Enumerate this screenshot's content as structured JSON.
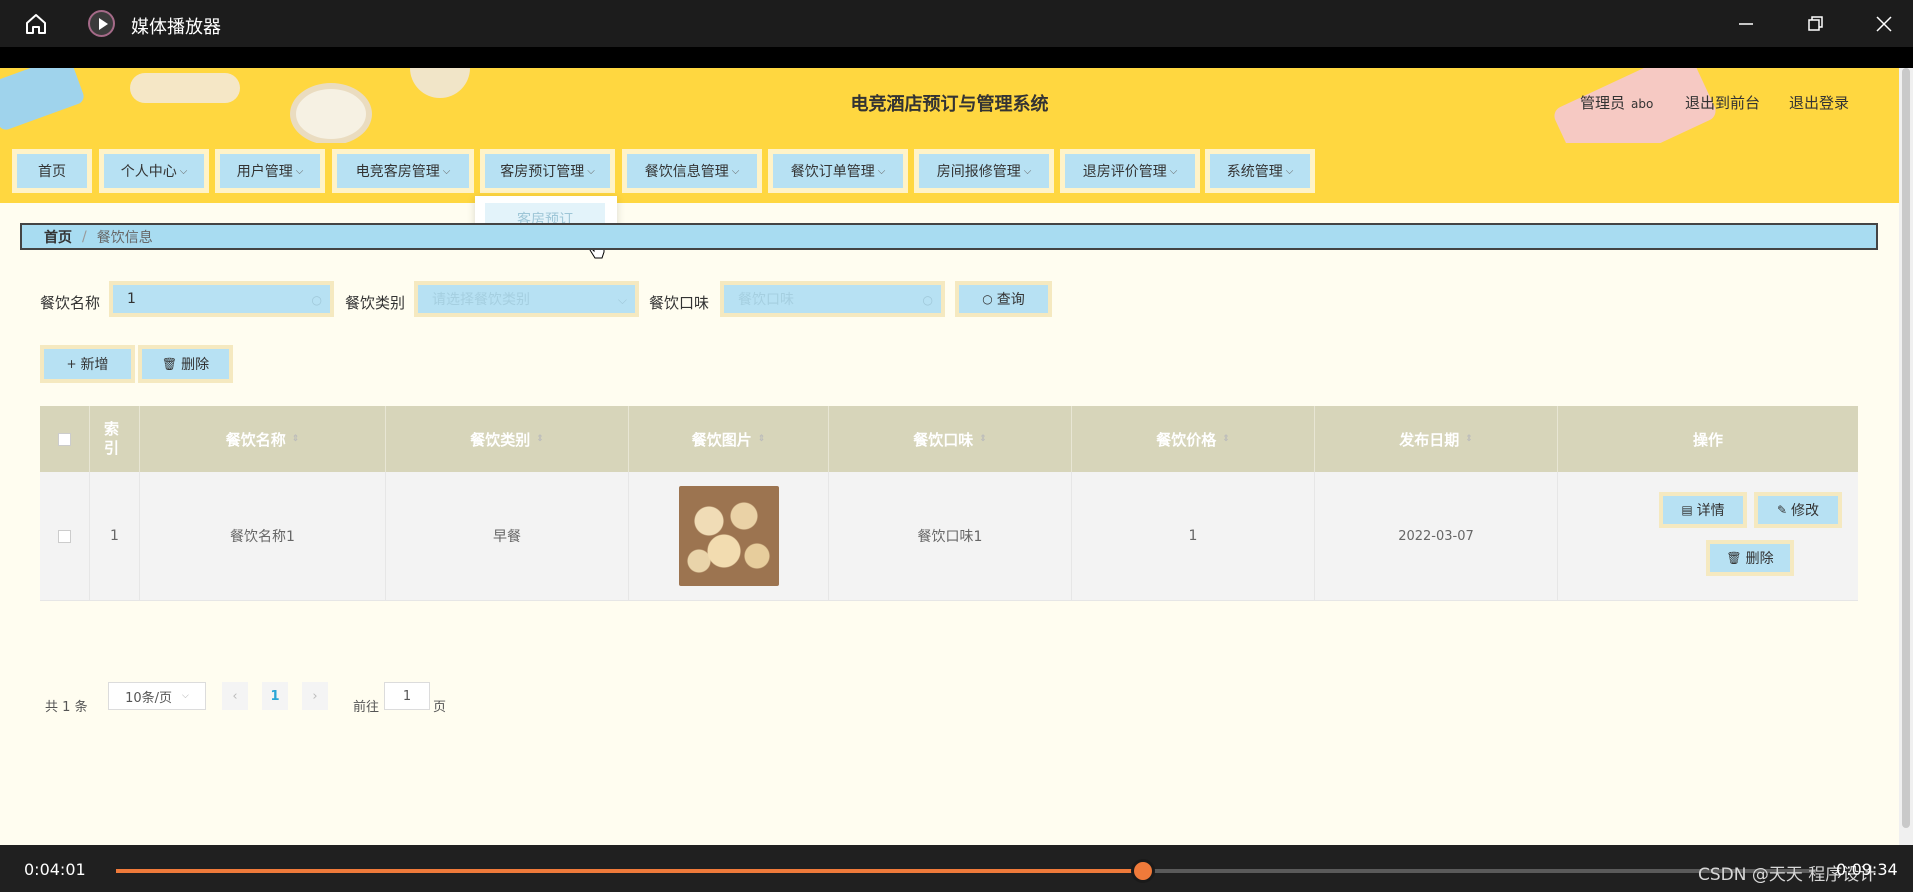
{
  "window": {
    "app_name": "媒体播放器"
  },
  "header": {
    "site_title": "电竞酒店预订与管理系统",
    "user_role": "管理员",
    "user_name": "abo",
    "back_to_front": "退出到前台",
    "logout": "退出登录"
  },
  "nav": {
    "items": [
      "首页",
      "个人中心",
      "用户管理",
      "电竞客房管理",
      "客房预订管理",
      "餐饮信息管理",
      "餐饮订单管理",
      "房间报修管理",
      "退房评价管理",
      "系统管理"
    ],
    "dropdown_item": "客房预订"
  },
  "breadcrumb": {
    "home": "首页",
    "current": "餐饮信息"
  },
  "search": {
    "name_label": "餐饮名称",
    "name_value": "1",
    "category_label": "餐饮类别",
    "category_placeholder": "请选择餐饮类别",
    "taste_label": "餐饮口味",
    "taste_placeholder": "餐饮口味",
    "query_button": "查询"
  },
  "actions": {
    "add": "新增",
    "delete": "删除"
  },
  "table": {
    "headers": {
      "index": "索引",
      "name": "餐饮名称",
      "category": "餐饮类别",
      "image": "餐饮图片",
      "taste": "餐饮口味",
      "price": "餐饮价格",
      "date": "发布日期",
      "ops": "操作"
    },
    "rows": [
      {
        "index": "1",
        "name": "餐饮名称1",
        "category": "早餐",
        "taste": "餐饮口味1",
        "price": "1",
        "date": "2022-03-07",
        "detail": "详情",
        "edit": "修改",
        "delete": "删除"
      }
    ]
  },
  "pagination": {
    "total_prefix": "共",
    "total": "1",
    "total_suffix": "条",
    "page_size": "10条/页",
    "current_page": "1",
    "goto_label": "前往",
    "goto_value": "1",
    "page_suffix": "页"
  },
  "player": {
    "elapsed": "0:04:01",
    "duration": "0:09:34",
    "progress": 0.604,
    "watermark": "CSDN @天天 程序设计"
  },
  "colors": {
    "accent_yellow": "#ffd740",
    "light_blue": "#b7e1f3",
    "table_head": "#d7d5ba",
    "progress": "#ef7a3a"
  }
}
